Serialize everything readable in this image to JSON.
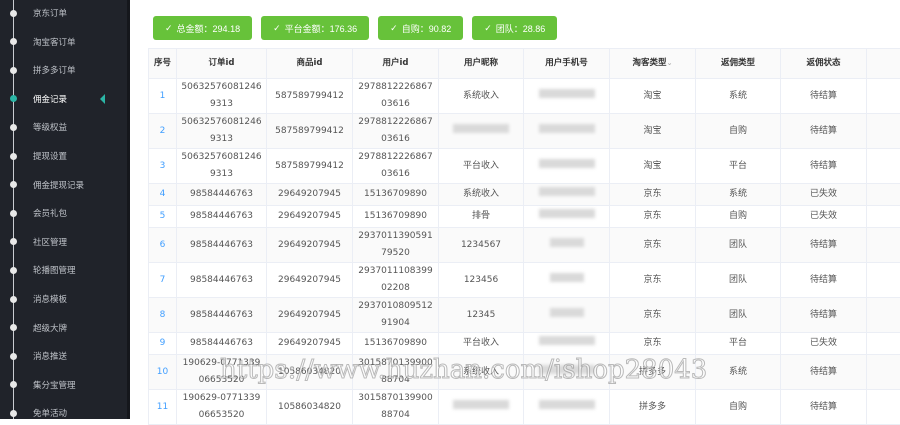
{
  "sidebar": {
    "items": [
      {
        "label": "京东订单"
      },
      {
        "label": "淘宝客订单"
      },
      {
        "label": "拼多多订单"
      },
      {
        "label": "佣金记录",
        "active": true
      },
      {
        "label": "等级权益"
      },
      {
        "label": "提现设置"
      },
      {
        "label": "佣金提现记录"
      },
      {
        "label": "会员礼包"
      },
      {
        "label": "社区管理"
      },
      {
        "label": "轮播图管理"
      },
      {
        "label": "消息模板"
      },
      {
        "label": "超级大牌"
      },
      {
        "label": "消息推送"
      },
      {
        "label": "集分宝管理"
      },
      {
        "label": "免单活动"
      }
    ]
  },
  "summary": [
    {
      "label": "总金额：294.18"
    },
    {
      "label": "平台金额：176.36"
    },
    {
      "label": "自购：90.82"
    },
    {
      "label": "团队：28.86"
    }
  ],
  "table": {
    "headers": [
      "序号",
      "订单id",
      "商品id",
      "用户id",
      "用户昵称",
      "用户手机号",
      "淘客类型",
      "返佣类型",
      "返佣状态",
      ""
    ],
    "rows": [
      {
        "no": "1",
        "order": "506325760812469313",
        "goods": "587589799412",
        "uid": "297881222686703616",
        "nick": "系统收入",
        "platform": "淘宝",
        "type": "系统",
        "status": "待结算"
      },
      {
        "no": "2",
        "order": "506325760812469313",
        "goods": "587589799412",
        "uid": "297881222686703616",
        "nick": "",
        "platform": "淘宝",
        "type": "自购",
        "status": "待结算"
      },
      {
        "no": "3",
        "order": "506325760812469313",
        "goods": "587589799412",
        "uid": "297881222686703616",
        "nick": "平台收入",
        "platform": "淘宝",
        "type": "平台",
        "status": "待结算"
      },
      {
        "no": "4",
        "order": "98584446763",
        "goods": "29649207945",
        "uid": "15136709890",
        "nick": "系统收入",
        "platform": "京东",
        "type": "系统",
        "status": "已失效"
      },
      {
        "no": "5",
        "order": "98584446763",
        "goods": "29649207945",
        "uid": "15136709890",
        "nick": "排骨",
        "platform": "京东",
        "type": "自购",
        "status": "已失效"
      },
      {
        "no": "6",
        "order": "98584446763",
        "goods": "29649207945",
        "uid": "293701139059179520",
        "nick": "1234567",
        "platform": "京东",
        "type": "团队",
        "status": "待结算"
      },
      {
        "no": "7",
        "order": "98584446763",
        "goods": "29649207945",
        "uid": "293701110839902208",
        "nick": "123456",
        "platform": "京东",
        "type": "团队",
        "status": "待结算"
      },
      {
        "no": "8",
        "order": "98584446763",
        "goods": "29649207945",
        "uid": "293701080951291904",
        "nick": "12345",
        "platform": "京东",
        "type": "团队",
        "status": "待结算"
      },
      {
        "no": "9",
        "order": "98584446763",
        "goods": "29649207945",
        "uid": "15136709890",
        "nick": "平台收入",
        "platform": "京东",
        "type": "平台",
        "status": "已失效"
      },
      {
        "no": "10",
        "order": "190629-077133906653520",
        "goods": "10586034820",
        "uid": "301587013990088704",
        "nick": "系统收入",
        "platform": "拼多多",
        "type": "系统",
        "status": "待结算"
      },
      {
        "no": "11",
        "order": "190629-077133906653520",
        "goods": "10586034820",
        "uid": "301587013990088704",
        "nick": "",
        "platform": "拼多多",
        "type": "自购",
        "status": "待结算"
      }
    ]
  },
  "watermark": "https://www.huzhan.com/ishop28043"
}
